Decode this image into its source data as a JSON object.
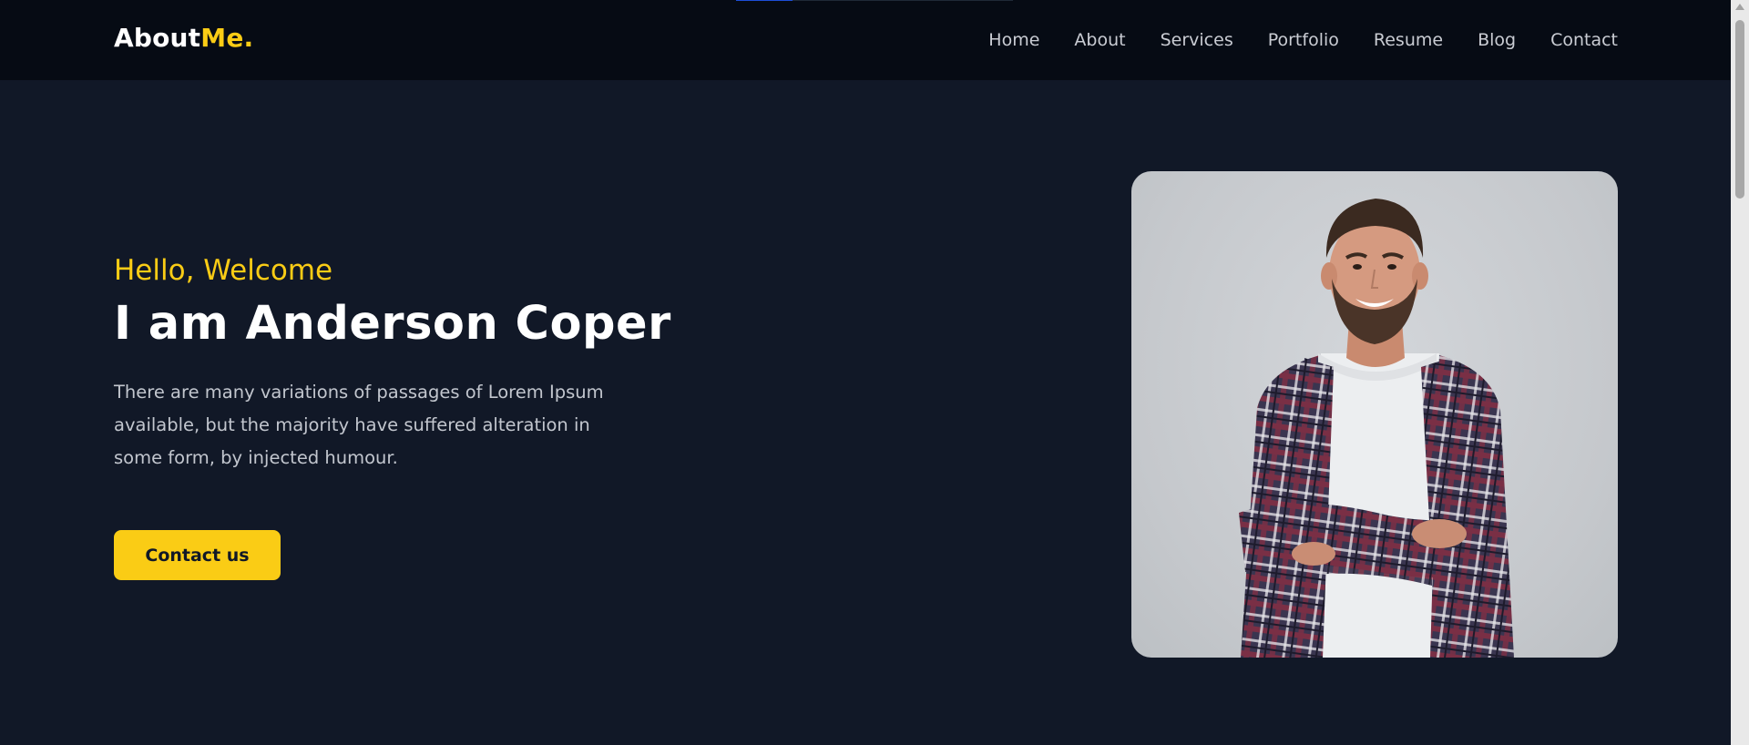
{
  "header": {
    "logo_main": "About",
    "logo_accent": "Me.",
    "nav": [
      {
        "label": "Home"
      },
      {
        "label": "About"
      },
      {
        "label": "Services"
      },
      {
        "label": "Portfolio"
      },
      {
        "label": "Resume"
      },
      {
        "label": "Blog"
      },
      {
        "label": "Contact"
      }
    ]
  },
  "hero": {
    "greeting": "Hello, Welcome",
    "headline": "I am Anderson Coper",
    "description": "There are many variations of passages of Lorem Ipsum available, but the majority have suffered alteration in some form, by injected humour.",
    "cta_label": "Contact us"
  },
  "colors": {
    "background": "#111827",
    "header_background": "#060b14",
    "accent": "#facc15"
  }
}
